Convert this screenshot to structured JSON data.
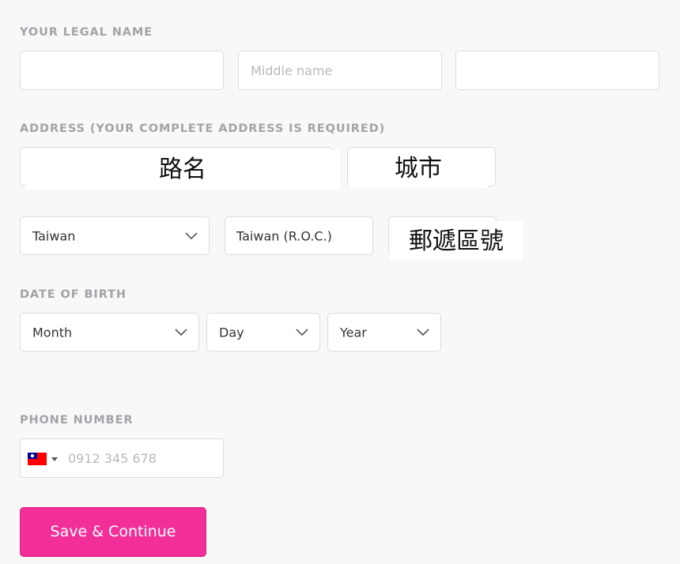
{
  "legal_name": {
    "label": "YOUR LEGAL NAME",
    "first_name": {
      "value": "",
      "placeholder": ""
    },
    "middle_name": {
      "value": "",
      "placeholder": "Middle name"
    },
    "last_name": {
      "value": "",
      "placeholder": ""
    }
  },
  "address": {
    "label": "ADDRESS (YOUR COMPLETE ADDRESS IS REQUIRED)",
    "street_label": "路名",
    "city_label": "城市",
    "country_select": "Taiwan",
    "state_value": "Taiwan (R.O.C.)",
    "postal_label": "郵遞區號"
  },
  "dob": {
    "label": "DATE OF BIRTH",
    "month": "Month",
    "day": "Day",
    "year": "Year"
  },
  "phone": {
    "label": "PHONE NUMBER",
    "country_flag": "taiwan-flag-icon",
    "placeholder": "0912 345 678",
    "value": ""
  },
  "actions": {
    "save_label": "Save & Continue",
    "save_color": "#f22f98"
  },
  "colors": {
    "label": "#a3a3a8",
    "border": "#dcdcde",
    "background": "#f8f8f9"
  }
}
